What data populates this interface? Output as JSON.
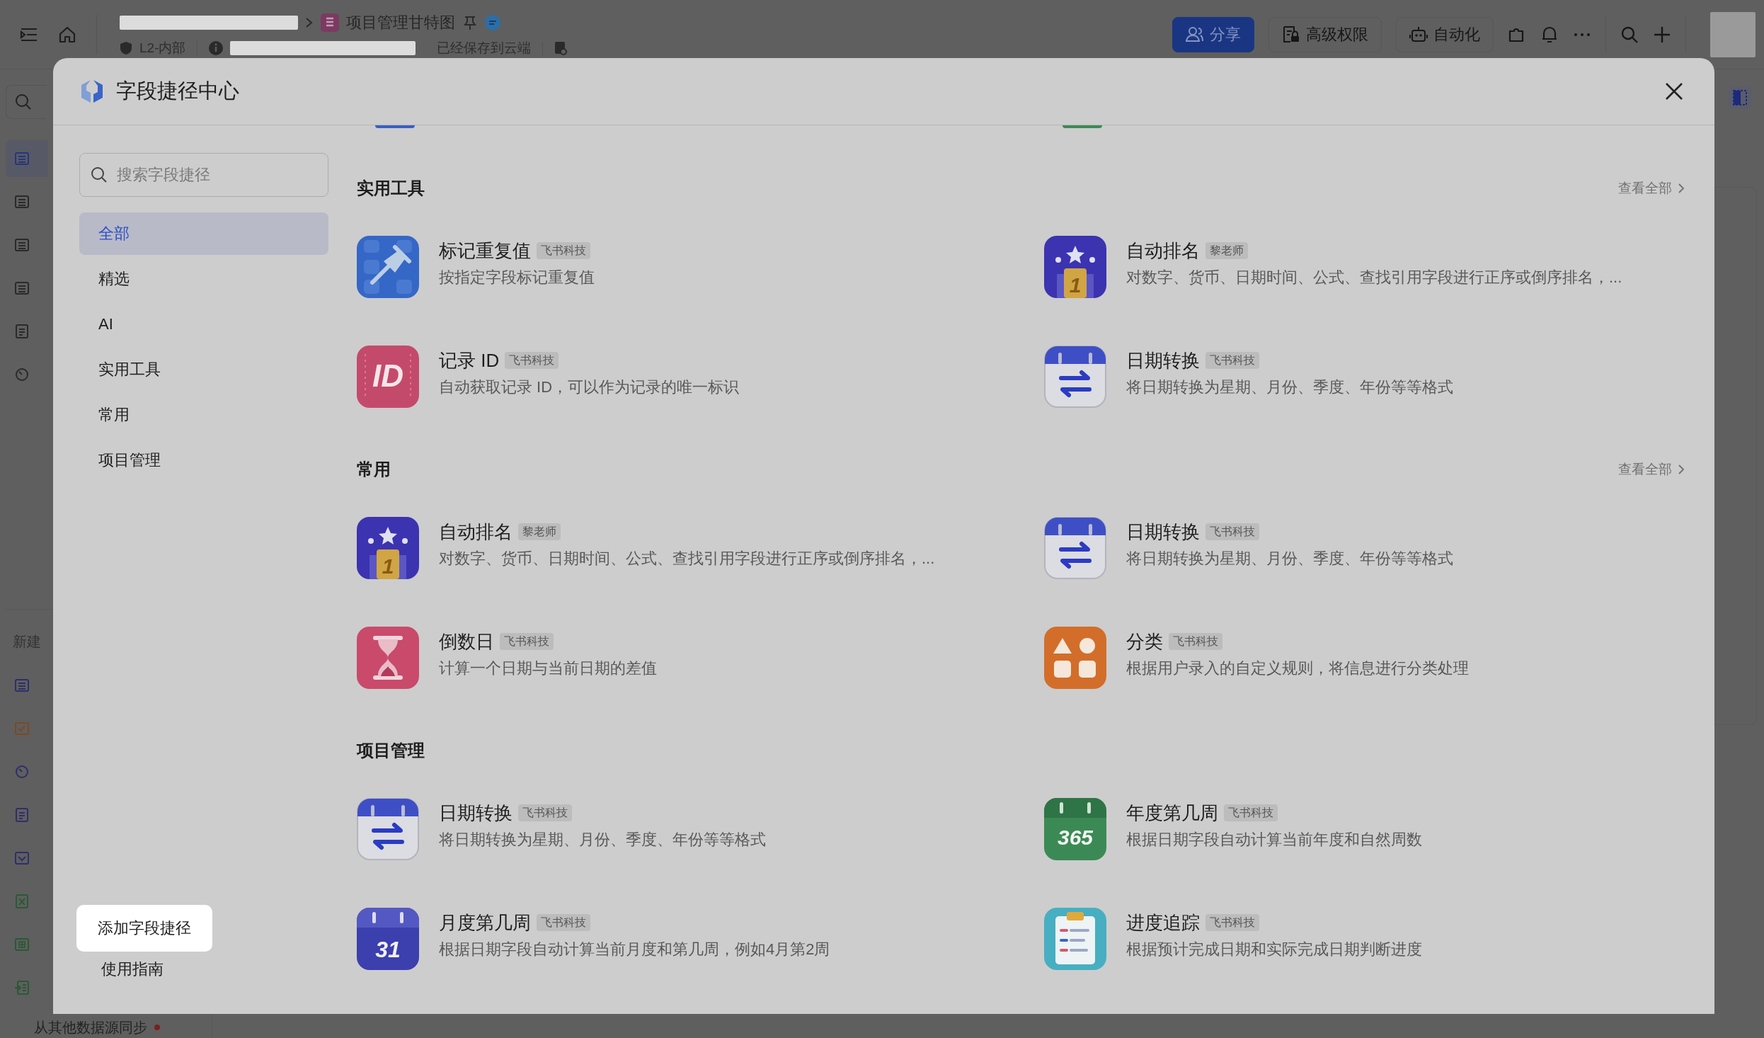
{
  "topbar": {
    "doc_title": "项目管理甘特图",
    "security_label": "L2-内部",
    "save_status": "已经保存到云端",
    "buttons": [
      {
        "label": "分享",
        "kind": "primary"
      },
      {
        "label": "高级权限",
        "kind": "permissions"
      },
      {
        "label": "自动化",
        "kind": "automation"
      }
    ]
  },
  "app_sidebar": {
    "top_items": [
      {
        "kind": "table",
        "selected": true
      },
      {
        "kind": "table",
        "selected": false
      },
      {
        "kind": "table",
        "selected": false
      },
      {
        "kind": "table",
        "selected": false
      },
      {
        "kind": "doc",
        "selected": false
      },
      {
        "kind": "dashboard",
        "selected": false
      }
    ],
    "new_label": "新建",
    "new_items": [
      {
        "kind": "table"
      },
      {
        "kind": "form"
      },
      {
        "kind": "dashboard"
      },
      {
        "kind": "doc"
      },
      {
        "kind": "check"
      },
      {
        "kind": "excel"
      },
      {
        "kind": "grid"
      },
      {
        "kind": "sync"
      }
    ],
    "sync_label": "从其他数据源同步"
  },
  "modal": {
    "title": "字段捷径中心",
    "search": {
      "placeholder": "搜索字段捷径"
    },
    "categories": [
      {
        "label": "全部",
        "selected": true
      },
      {
        "label": "精选",
        "selected": false
      },
      {
        "label": "AI",
        "selected": false
      },
      {
        "label": "实用工具",
        "selected": false
      },
      {
        "label": "常用",
        "selected": false
      },
      {
        "label": "项目管理",
        "selected": false
      }
    ],
    "add_button": "添加字段捷径",
    "guide_link": "使用指南",
    "sections": [
      {
        "title": "实用工具",
        "view_all": "查看全部",
        "items": [
          {
            "kind": "pin",
            "name": "标记重复值",
            "tag": "飞书科技",
            "description": "按指定字段标记重复值"
          },
          {
            "kind": "ranking",
            "icon_text": "1",
            "name": "自动排名",
            "tag": "黎老师",
            "description": "对数字、货币、日期时间、公式、查找引用字段进行正序或倒序排名，..."
          },
          {
            "kind": "id",
            "icon_text": "ID",
            "name": "记录 ID",
            "tag": "飞书科技",
            "description": "自动获取记录 ID，可以作为记录的唯一标识"
          },
          {
            "kind": "date-convert",
            "name": "日期转换",
            "tag": "飞书科技",
            "description": "将日期转换为星期、月份、季度、年份等等格式"
          }
        ]
      },
      {
        "title": "常用",
        "view_all": "查看全部",
        "items": [
          {
            "kind": "ranking",
            "icon_text": "1",
            "name": "自动排名",
            "tag": "黎老师",
            "description": "对数字、货币、日期时间、公式、查找引用字段进行正序或倒序排名，..."
          },
          {
            "kind": "date-convert",
            "name": "日期转换",
            "tag": "飞书科技",
            "description": "将日期转换为星期、月份、季度、年份等等格式"
          },
          {
            "kind": "countdown",
            "name": "倒数日",
            "tag": "飞书科技",
            "description": "计算一个日期与当前日期的差值"
          },
          {
            "kind": "classify",
            "name": "分类",
            "tag": "飞书科技",
            "description": "根据用户录入的自定义规则，将信息进行分类处理"
          }
        ]
      },
      {
        "title": "项目管理",
        "items": [
          {
            "kind": "date-convert",
            "name": "日期转换",
            "tag": "飞书科技",
            "description": "将日期转换为星期、月份、季度、年份等等格式"
          },
          {
            "kind": "calendar-green",
            "icon_text": "365",
            "name": "年度第几周",
            "tag": "飞书科技",
            "description": "根据日期字段自动计算当前年度和自然周数"
          },
          {
            "kind": "calendar-indigo",
            "icon_text": "31",
            "name": "月度第几周",
            "tag": "飞书科技",
            "description": "根据日期字段自动计算当前月度和第几周，例如4月第2周"
          },
          {
            "kind": "progress",
            "name": "进度追踪",
            "tag": "飞书科技",
            "description": "根据预计完成日期和实际完成日期判断进度"
          }
        ]
      }
    ]
  }
}
